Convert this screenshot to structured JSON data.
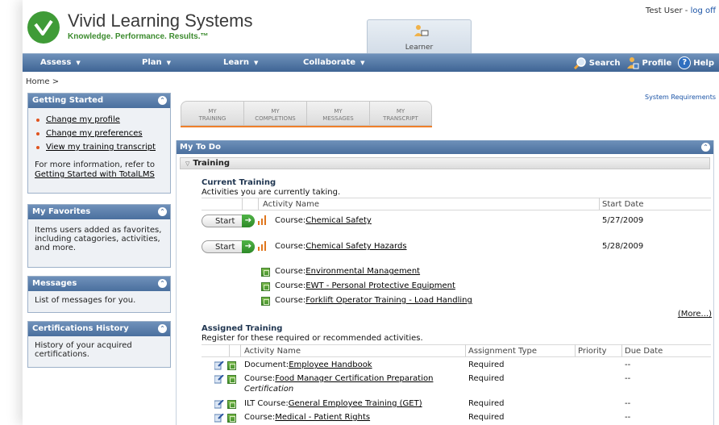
{
  "header": {
    "brand": "Vivid Learning Systems",
    "tagline": "Knowledge. Performance. Results.™",
    "role_tab": "Learner",
    "user_name": "Test User",
    "separator": " - ",
    "logoff": "log off"
  },
  "nav": {
    "items": [
      "Assess",
      "Plan",
      "Learn",
      "Collaborate"
    ],
    "search": "Search",
    "profile": "Profile",
    "help": "Help"
  },
  "breadcrumb": "Home >",
  "system_requirements": "System Requirements",
  "main_tabs": [
    {
      "line1": "MY",
      "line2": "TRAINING"
    },
    {
      "line1": "MY",
      "line2": "COMPLETIONS"
    },
    {
      "line1": "MY",
      "line2": "MESSAGES"
    },
    {
      "line1": "MY",
      "line2": "TRANSCRIPT"
    }
  ],
  "sidebar": {
    "getting_started": {
      "title": "Getting Started",
      "links": [
        "Change my profile",
        "Change my preferences",
        "View my training transcript"
      ],
      "note": "For more information, refer to",
      "note_link": "Getting Started with TotalLMS"
    },
    "favorites": {
      "title": "My Favorites",
      "text": "Items users added as favorites, including catagories, activities, and more."
    },
    "messages": {
      "title": "Messages",
      "text": "List of messages for you."
    },
    "certifications": {
      "title": "Certifications History",
      "text": "History of your acquired certifications."
    }
  },
  "todo": {
    "title": "My To Do",
    "section": "Training",
    "current": {
      "title": "Current Training",
      "subtitle": "Activities you are currently taking.",
      "col_activity": "Activity Name",
      "col_start": "Start Date",
      "start_label": "Start",
      "rows": [
        {
          "type": "Course:",
          "name": "Chemical Safety",
          "date": "5/27/2009"
        },
        {
          "type": "Course:",
          "name": "Chemical Safety Hazards",
          "date": "5/28/2009"
        },
        {
          "type": "Course:",
          "name": "Environmental Management",
          "date": ""
        },
        {
          "type": "Course:",
          "name": "EWT - Personal Protective Equipment",
          "date": ""
        },
        {
          "type": "Course:",
          "name": "Forklift Operator Training - Load Handling",
          "date": ""
        }
      ],
      "more": "(More...)"
    },
    "assigned": {
      "title": "Assigned Training",
      "subtitle": "Register for these required or recommended activities.",
      "col_activity": "Activity Name",
      "col_type": "Assignment Type",
      "col_priority": "Priority",
      "col_due": "Due Date",
      "rows": [
        {
          "type": "Document:",
          "name": "Employee Handbook",
          "extra": "",
          "assignment": "Required",
          "due": "--"
        },
        {
          "type": "Course:",
          "name": "Food Manager Certification Preparation",
          "extra": "Certification",
          "assignment": "Required",
          "due": "--"
        },
        {
          "type": "ILT Course:",
          "name": "General Employee Training (GET)",
          "extra": "",
          "assignment": "Required",
          "due": "--"
        },
        {
          "type": "Course:",
          "name": "Medical - Patient Rights",
          "extra": "",
          "assignment": "Required",
          "due": "--"
        }
      ]
    }
  }
}
